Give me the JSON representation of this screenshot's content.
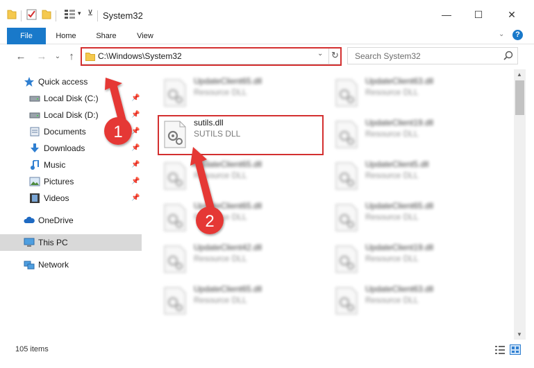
{
  "window": {
    "title": "System32",
    "minimize": "—",
    "maximize": "☐",
    "close": "✕"
  },
  "ribbon": {
    "tabs": [
      "File",
      "Home",
      "Share",
      "View"
    ],
    "help": "?"
  },
  "address": {
    "path": "C:\\Windows\\System32"
  },
  "search": {
    "placeholder": "Search System32"
  },
  "nav": {
    "items": [
      {
        "label": "Quick access",
        "icon": "star-icon",
        "pinned": false
      },
      {
        "label": "Local Disk (C:)",
        "icon": "drive-icon",
        "pinned": true
      },
      {
        "label": "Local Disk (D:)",
        "icon": "drive-icon",
        "pinned": true
      },
      {
        "label": "Documents",
        "icon": "documents-icon",
        "pinned": true
      },
      {
        "label": "Downloads",
        "icon": "downloads-icon",
        "pinned": true
      },
      {
        "label": "Music",
        "icon": "music-icon",
        "pinned": true
      },
      {
        "label": "Pictures",
        "icon": "pictures-icon",
        "pinned": true
      },
      {
        "label": "Videos",
        "icon": "videos-icon",
        "pinned": true
      },
      {
        "label": "OneDrive",
        "icon": "cloud-icon",
        "pinned": false
      },
      {
        "label": "This PC",
        "icon": "computer-icon",
        "pinned": false,
        "selected": true
      },
      {
        "label": "Network",
        "icon": "network-icon",
        "pinned": false
      }
    ]
  },
  "files": {
    "left": [
      {
        "name": "UpdateClient65.dll",
        "type": "Resource DLL",
        "blurred": true
      },
      {
        "name": "sutils.dll",
        "type": "SUTILS DLL",
        "blurred": false
      },
      {
        "name": "UpdateClient65.dll",
        "type": "Resource DLL",
        "blurred": true
      },
      {
        "name": "UpdateClient65.dll",
        "type": "Resource DLL",
        "blurred": true
      },
      {
        "name": "UpdateClient42.dll",
        "type": "Resource DLL",
        "blurred": true
      },
      {
        "name": "UpdateClient65.dll",
        "type": "Resource DLL",
        "blurred": true
      }
    ],
    "right": [
      {
        "name": "UpdateClient63.dll",
        "type": "Resource DLL",
        "blurred": true
      },
      {
        "name": "UpdateClient19.dll",
        "type": "Resource DLL",
        "blurred": true
      },
      {
        "name": "UpdateClient5.dll",
        "type": "Resource DLL",
        "blurred": true
      },
      {
        "name": "UpdateClient65.dll",
        "type": "Resource DLL",
        "blurred": true
      },
      {
        "name": "UpdateClient19.dll",
        "type": "Resource DLL",
        "blurred": true
      },
      {
        "name": "UpdateClient63.dll",
        "type": "Resource DLL",
        "blurred": true
      }
    ]
  },
  "status": {
    "count": "105 items"
  },
  "annotations": {
    "step1": "1",
    "step2": "2",
    "color": "#d32f2f"
  },
  "colors": {
    "accent": "#1979ca",
    "selection": "#d9d9d9"
  }
}
